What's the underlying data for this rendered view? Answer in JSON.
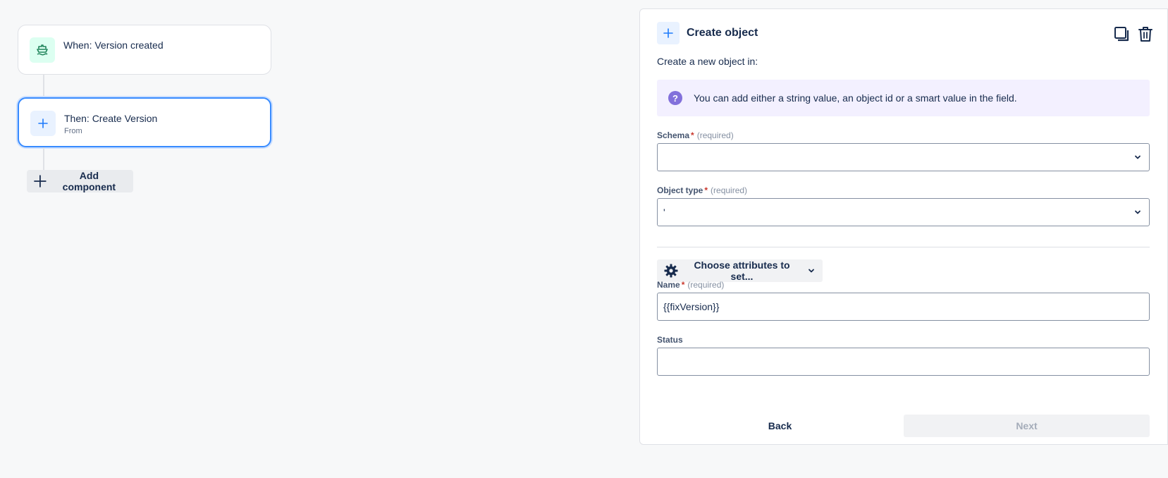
{
  "flow": {
    "trigger": {
      "title": "When: Version created",
      "icon": "ship-icon"
    },
    "action": {
      "title": "Then: Create Version",
      "subtitle": "From",
      "icon": "plus-icon"
    },
    "add_component_label": "Add component"
  },
  "panel": {
    "title": "Create object",
    "subtitle": "Create a new object in:",
    "info": "You can add either a string value, an object id or a smart value in the field.",
    "fields": {
      "schema": {
        "label": "Schema",
        "required_mark": "*",
        "hint": "(required)",
        "value": ""
      },
      "object_type": {
        "label": "Object type",
        "required_mark": "*",
        "hint": "(required)",
        "value": "'"
      },
      "attributes_button": "Choose attributes to set...",
      "name": {
        "label": "Name",
        "required_mark": "*",
        "hint": "(required)",
        "value": "{{fixVersion}}"
      },
      "status": {
        "label": "Status",
        "value": ""
      }
    },
    "back_label": "Back",
    "next_label": "Next"
  },
  "colors": {
    "accent": "#388bff",
    "info_bg": "#f3f0ff",
    "info_icon": "#8270db",
    "trigger_icon_bg": "#dcfff1"
  }
}
